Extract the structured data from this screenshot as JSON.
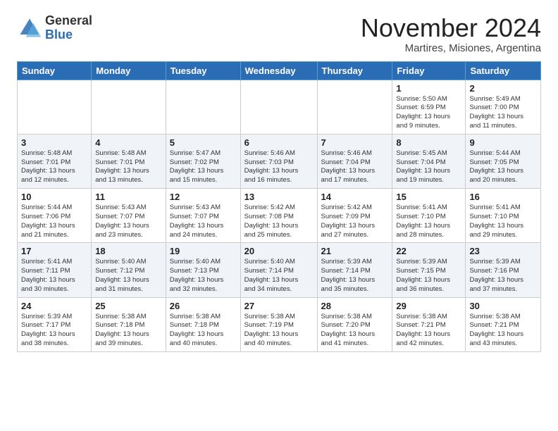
{
  "logo": {
    "general": "General",
    "blue": "Blue"
  },
  "title": "November 2024",
  "subtitle": "Martires, Misiones, Argentina",
  "days_of_week": [
    "Sunday",
    "Monday",
    "Tuesday",
    "Wednesday",
    "Thursday",
    "Friday",
    "Saturday"
  ],
  "weeks": [
    [
      {
        "day": "",
        "info": ""
      },
      {
        "day": "",
        "info": ""
      },
      {
        "day": "",
        "info": ""
      },
      {
        "day": "",
        "info": ""
      },
      {
        "day": "",
        "info": ""
      },
      {
        "day": "1",
        "info": "Sunrise: 5:50 AM\nSunset: 6:59 PM\nDaylight: 13 hours\nand 9 minutes."
      },
      {
        "day": "2",
        "info": "Sunrise: 5:49 AM\nSunset: 7:00 PM\nDaylight: 13 hours\nand 11 minutes."
      }
    ],
    [
      {
        "day": "3",
        "info": "Sunrise: 5:48 AM\nSunset: 7:01 PM\nDaylight: 13 hours\nand 12 minutes."
      },
      {
        "day": "4",
        "info": "Sunrise: 5:48 AM\nSunset: 7:01 PM\nDaylight: 13 hours\nand 13 minutes."
      },
      {
        "day": "5",
        "info": "Sunrise: 5:47 AM\nSunset: 7:02 PM\nDaylight: 13 hours\nand 15 minutes."
      },
      {
        "day": "6",
        "info": "Sunrise: 5:46 AM\nSunset: 7:03 PM\nDaylight: 13 hours\nand 16 minutes."
      },
      {
        "day": "7",
        "info": "Sunrise: 5:46 AM\nSunset: 7:04 PM\nDaylight: 13 hours\nand 17 minutes."
      },
      {
        "day": "8",
        "info": "Sunrise: 5:45 AM\nSunset: 7:04 PM\nDaylight: 13 hours\nand 19 minutes."
      },
      {
        "day": "9",
        "info": "Sunrise: 5:44 AM\nSunset: 7:05 PM\nDaylight: 13 hours\nand 20 minutes."
      }
    ],
    [
      {
        "day": "10",
        "info": "Sunrise: 5:44 AM\nSunset: 7:06 PM\nDaylight: 13 hours\nand 21 minutes."
      },
      {
        "day": "11",
        "info": "Sunrise: 5:43 AM\nSunset: 7:07 PM\nDaylight: 13 hours\nand 23 minutes."
      },
      {
        "day": "12",
        "info": "Sunrise: 5:43 AM\nSunset: 7:07 PM\nDaylight: 13 hours\nand 24 minutes."
      },
      {
        "day": "13",
        "info": "Sunrise: 5:42 AM\nSunset: 7:08 PM\nDaylight: 13 hours\nand 25 minutes."
      },
      {
        "day": "14",
        "info": "Sunrise: 5:42 AM\nSunset: 7:09 PM\nDaylight: 13 hours\nand 27 minutes."
      },
      {
        "day": "15",
        "info": "Sunrise: 5:41 AM\nSunset: 7:10 PM\nDaylight: 13 hours\nand 28 minutes."
      },
      {
        "day": "16",
        "info": "Sunrise: 5:41 AM\nSunset: 7:10 PM\nDaylight: 13 hours\nand 29 minutes."
      }
    ],
    [
      {
        "day": "17",
        "info": "Sunrise: 5:41 AM\nSunset: 7:11 PM\nDaylight: 13 hours\nand 30 minutes."
      },
      {
        "day": "18",
        "info": "Sunrise: 5:40 AM\nSunset: 7:12 PM\nDaylight: 13 hours\nand 31 minutes."
      },
      {
        "day": "19",
        "info": "Sunrise: 5:40 AM\nSunset: 7:13 PM\nDaylight: 13 hours\nand 32 minutes."
      },
      {
        "day": "20",
        "info": "Sunrise: 5:40 AM\nSunset: 7:14 PM\nDaylight: 13 hours\nand 34 minutes."
      },
      {
        "day": "21",
        "info": "Sunrise: 5:39 AM\nSunset: 7:14 PM\nDaylight: 13 hours\nand 35 minutes."
      },
      {
        "day": "22",
        "info": "Sunrise: 5:39 AM\nSunset: 7:15 PM\nDaylight: 13 hours\nand 36 minutes."
      },
      {
        "day": "23",
        "info": "Sunrise: 5:39 AM\nSunset: 7:16 PM\nDaylight: 13 hours\nand 37 minutes."
      }
    ],
    [
      {
        "day": "24",
        "info": "Sunrise: 5:39 AM\nSunset: 7:17 PM\nDaylight: 13 hours\nand 38 minutes."
      },
      {
        "day": "25",
        "info": "Sunrise: 5:38 AM\nSunset: 7:18 PM\nDaylight: 13 hours\nand 39 minutes."
      },
      {
        "day": "26",
        "info": "Sunrise: 5:38 AM\nSunset: 7:18 PM\nDaylight: 13 hours\nand 40 minutes."
      },
      {
        "day": "27",
        "info": "Sunrise: 5:38 AM\nSunset: 7:19 PM\nDaylight: 13 hours\nand 40 minutes."
      },
      {
        "day": "28",
        "info": "Sunrise: 5:38 AM\nSunset: 7:20 PM\nDaylight: 13 hours\nand 41 minutes."
      },
      {
        "day": "29",
        "info": "Sunrise: 5:38 AM\nSunset: 7:21 PM\nDaylight: 13 hours\nand 42 minutes."
      },
      {
        "day": "30",
        "info": "Sunrise: 5:38 AM\nSunset: 7:21 PM\nDaylight: 13 hours\nand 43 minutes."
      }
    ]
  ]
}
